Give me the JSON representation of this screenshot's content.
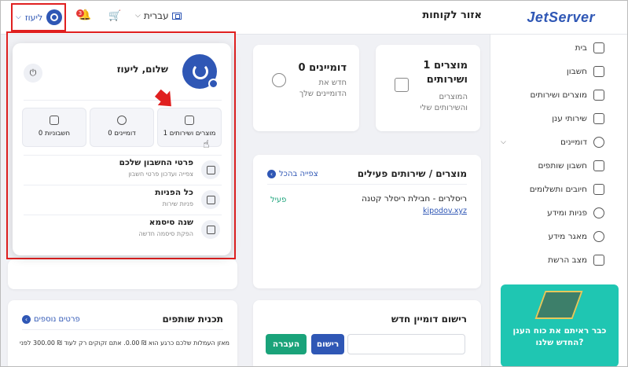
{
  "header": {
    "logo": "JetServer",
    "area_title": "אזור לקוחות",
    "language": "עברית",
    "notifications_count": "3",
    "user_name": "ליעוז"
  },
  "sidebar": {
    "items": [
      {
        "label": "בית",
        "icon": "home-icon"
      },
      {
        "label": "חשבון",
        "icon": "user-icon"
      },
      {
        "label": "מוצרים ושירותים",
        "icon": "box-icon"
      },
      {
        "label": "שירותי ענן",
        "icon": "cloud-icon"
      },
      {
        "label": "דומיינים",
        "icon": "globe-icon"
      },
      {
        "label": "חשבון שותפים",
        "icon": "partners-icon"
      },
      {
        "label": "חיובים ותשלומים",
        "icon": "invoice-icon"
      },
      {
        "label": "פניות ומידע",
        "icon": "headset-icon"
      },
      {
        "label": "מאגר מידע",
        "icon": "bulb-icon"
      },
      {
        "label": "מצב הרשת",
        "icon": "chart-icon"
      }
    ],
    "promo_text": "כבר ראיתם את כוח הענן החדש שלנו?"
  },
  "stats": {
    "products_count": "1 מוצרים ושירותים",
    "products_sub": "המוצרים והשירותים שלי",
    "domains_count": "0 דומיינים",
    "domains_sub": "חדש את הדומיינים שלך"
  },
  "active_services": {
    "title": "מוצרים / שירותים פעילים",
    "view_all": "צפייה בהכל",
    "service_name": "ריסלרים - חבילת ריסלר קטנה",
    "service_domain": "kipodov.xyz",
    "service_status": "פעיל"
  },
  "domain_register": {
    "title": "רישום דומיין חדש",
    "register_btn": "רישום",
    "transfer_btn": "העברה"
  },
  "affiliate": {
    "title": "תכנית שותפים",
    "more_link": "פרטים נוספים",
    "text": "מאזן העמלות שלכם כרגע הוא ₪ 0.00. אתם זקוקים רק לעוד ₪ 300.00 לפני"
  },
  "dropdown": {
    "greeting": "שלום, ליעוז",
    "tiles": [
      {
        "label": "0 חשבוניות"
      },
      {
        "label": "0 דומיינים"
      },
      {
        "label": "1 מוצרים ושירותים"
      }
    ],
    "rows": [
      {
        "title": "פרטי החשבון שלכם",
        "sub": "צפייה ועדכון פרטי חשבון"
      },
      {
        "title": "כל הפניות",
        "sub": "פניות שירות"
      },
      {
        "title": "שנה סיסמא",
        "sub": "הפקת סיסמה חדשה"
      }
    ]
  },
  "colors": {
    "brand": "#2f57b5",
    "highlight": "#e02020",
    "teal": "#1fc6b2",
    "status_active": "#1aa37a"
  }
}
